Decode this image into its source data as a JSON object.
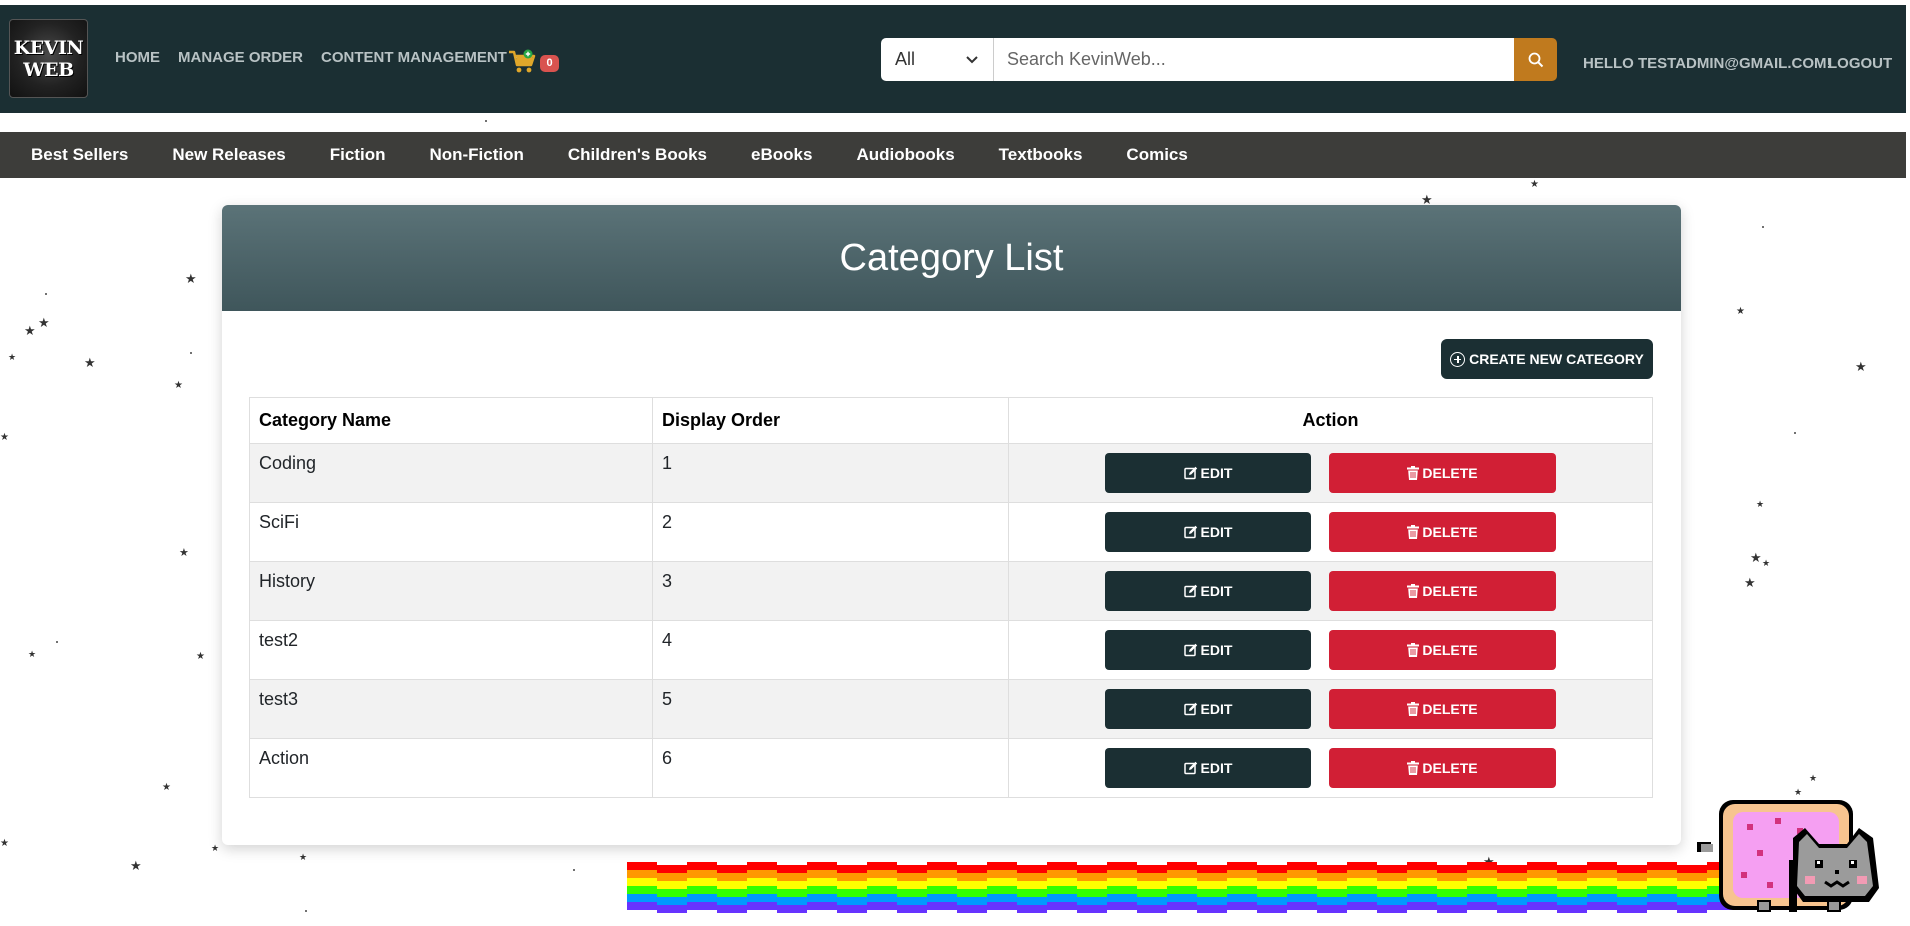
{
  "brand": {
    "logo_line1": "KEVIN",
    "logo_line2": "WEB"
  },
  "nav": {
    "home": "HOME",
    "manage_order": "MANAGE ORDER",
    "content_management": "CONTENT MANAGEMENT",
    "cart_count": "0",
    "greeting": "HELLO TESTADMIN@GMAIL.COM!",
    "logout": "LOGOUT"
  },
  "search": {
    "scope": "All",
    "placeholder": "Search KevinWeb...",
    "value": ""
  },
  "categories_bar": [
    "Best Sellers",
    "New Releases",
    "Fiction",
    "Non-Fiction",
    "Children's Books",
    "eBooks",
    "Audiobooks",
    "Textbooks",
    "Comics"
  ],
  "page": {
    "title": "Category List",
    "create_button": "CREATE NEW CATEGORY"
  },
  "table": {
    "headers": {
      "name": "Category Name",
      "order": "Display Order",
      "action": "Action"
    },
    "edit_label": "EDIT",
    "delete_label": "DELETE",
    "rows": [
      {
        "name": "Coding",
        "order": "1"
      },
      {
        "name": "SciFi",
        "order": "2"
      },
      {
        "name": "History",
        "order": "3"
      },
      {
        "name": "test2",
        "order": "4"
      },
      {
        "name": "test3",
        "order": "5"
      },
      {
        "name": "Action",
        "order": "6"
      }
    ]
  },
  "colors": {
    "navbar": "#1b2f33",
    "category_bar": "#3d3d3a",
    "search_button": "#c07a1e",
    "edit_button": "#1b2f33",
    "delete_button": "#d11f35",
    "cart_badge": "#d9534f"
  },
  "icons": {
    "search": "magnifier-icon",
    "cart": "cart-icon",
    "create": "plus-circle-icon",
    "edit": "pencil-square-icon",
    "delete": "trash-icon"
  }
}
